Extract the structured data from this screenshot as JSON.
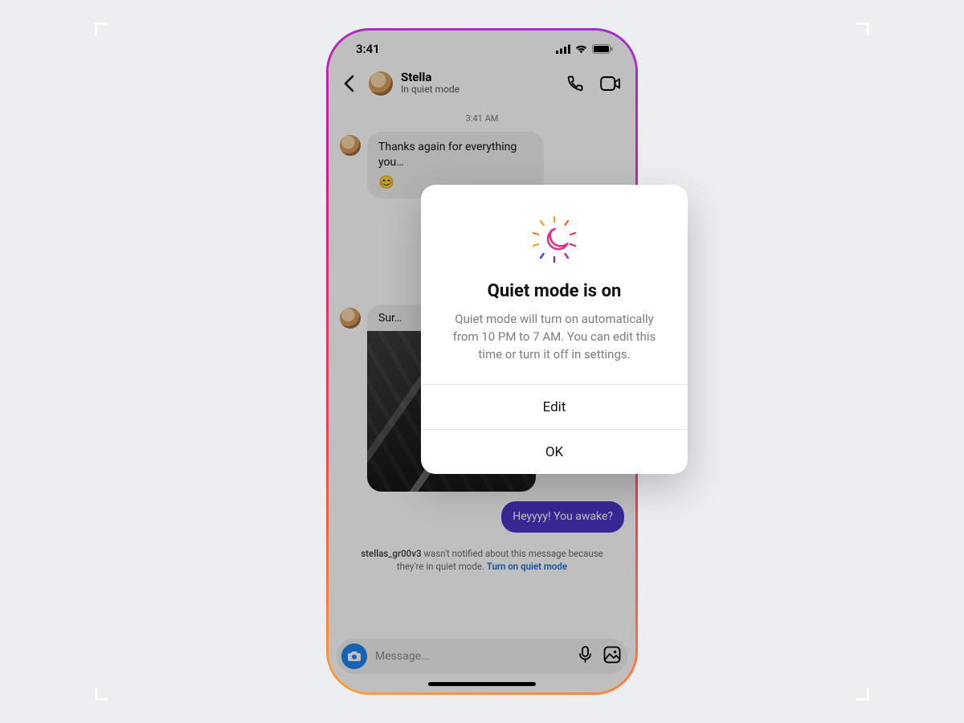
{
  "status_bar": {
    "time": "3:41"
  },
  "header": {
    "name": "Stella",
    "status": "In quiet mode"
  },
  "chat": {
    "timestamp": "3:41 AM",
    "msg1_text": "Thanks again for everything you…",
    "msg2_caption": "Sur…",
    "outgoing_text": "Heyyyy! You awake?"
  },
  "notice": {
    "username": "stellas_gr00v3",
    "text_middle": " wasn't notified about this message because they're in quiet mode. ",
    "link": "Turn on quiet mode"
  },
  "composer": {
    "placeholder": "Message..."
  },
  "dialog": {
    "title": "Quiet mode is on",
    "description": "Quiet mode will turn on automatically from 10 PM to 7 AM. You can edit this time or turn it off in settings.",
    "edit_label": "Edit",
    "ok_label": "OK"
  }
}
